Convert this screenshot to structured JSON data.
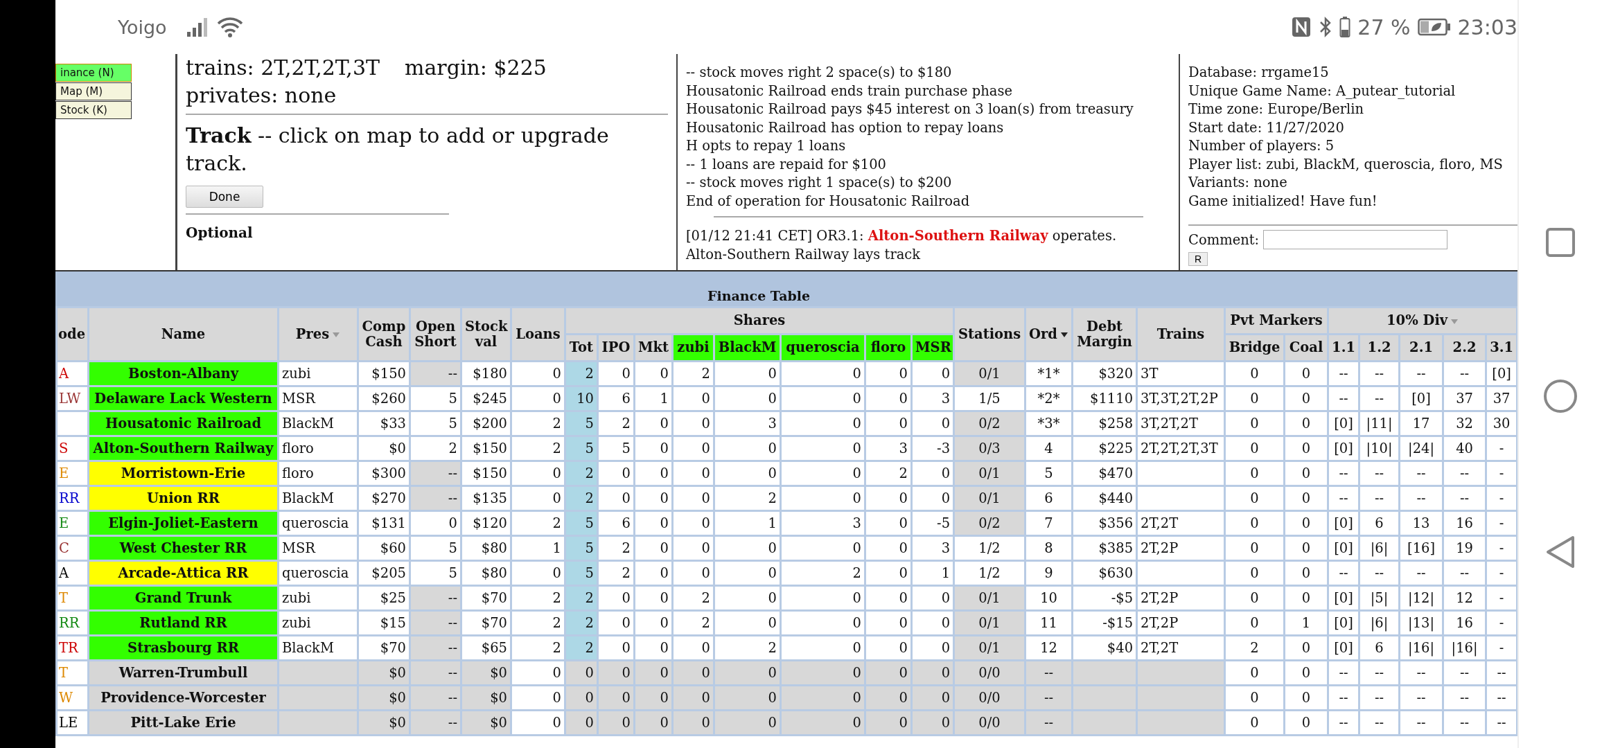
{
  "status_bar": {
    "carrier": "Yoigo",
    "battery": "27 %",
    "time": "23:03"
  },
  "view_buttons": [
    {
      "label": "inance (N)",
      "selected": true
    },
    {
      "label": "Map (M)",
      "selected": false
    },
    {
      "label": "Stock (K)",
      "selected": false
    }
  ],
  "action_panel": {
    "trains": "trains: 2T,2T,2T,3T",
    "margin": "margin: $225",
    "privates": "privates: none",
    "track": "**Track** -- click on map to add or upgrade track.",
    "done_button": "Done",
    "optional_heading": "Optional"
  },
  "log": {
    "lines": [
      "-- stock moves right 2 space(s) to $180",
      "Housatonic Railroad ends train purchase phase",
      "Housatonic Railroad pays $45 interest on 3 loan(s) from treasury",
      "Housatonic Railroad has option to repay loans",
      "H opts to repay 1 loans",
      "-- 1 loans are repaid for $100",
      "-- stock moves right 1 space(s) to $200",
      "End of operation for Housatonic Railroad"
    ],
    "entry": {
      "prefix": "[01/12 21:41 CET] OR3.1:",
      "company": "Alton-Southern Railway",
      "suffix": "operates.",
      "detail": "Alton-Southern Railway lays track"
    }
  },
  "game_info": {
    "lines": [
      "Database: rrgame15",
      "Unique Game Name: A_putear_tutorial",
      "Time zone: Europe/Berlin",
      "Start date: 11/27/2020",
      "Number of players: 5",
      "Player list: zubi, BlackM, queroscia, floro, MS",
      "Variants: none",
      "Game initialized! Have fun!"
    ],
    "comment_label": "Comment:",
    "reply_button": "R"
  },
  "finance_table": {
    "title": "Finance Table",
    "columns": [
      {
        "label": "ode",
        "sortable": false
      },
      {
        "label": "Name",
        "sortable": false
      },
      {
        "label": "Pres",
        "sortable": true
      },
      {
        "label": "Comp Cash",
        "sortable": false
      },
      {
        "label": "Open Short",
        "sortable": false
      },
      {
        "label": "Stock val",
        "sortable": false
      },
      {
        "label": "Loans",
        "sortable": false
      }
    ],
    "shares": {
      "label": "Shares",
      "columns": [
        {
          "label": "Tot",
          "player": false
        },
        {
          "label": "IPO",
          "player": false
        },
        {
          "label": "Mkt",
          "player": false
        },
        {
          "label": "zubi",
          "player": true
        },
        {
          "label": "BlackM",
          "player": true
        },
        {
          "label": "queroscia",
          "player": true
        },
        {
          "label": "floro",
          "player": true
        },
        {
          "label": "MSR",
          "player": true
        }
      ]
    },
    "tail_columns": [
      {
        "label": "Stations",
        "sortable": false
      },
      {
        "label": "Ord",
        "sortable": true
      },
      {
        "label": "Debt Margin",
        "sortable": false
      },
      {
        "label": "Trains",
        "sortable": false
      }
    ],
    "pvt_markers": {
      "label": "Pvt Markers",
      "columns": [
        "Bridge",
        "Coal"
      ]
    },
    "dividends": {
      "label": "10% Div",
      "sortable": true,
      "columns": [
        "1.1",
        "1.2",
        "2.1",
        "2.2",
        "3.1"
      ]
    },
    "rows": [
      {
        "code": {
          "text": "A",
          "color": "#cc0000"
        },
        "name": {
          "text": "Boston-Albany",
          "color": "#33ff00"
        },
        "inactive": false,
        "pres": "zubi",
        "cash": "$150",
        "open_short": "--",
        "short_shaded": true,
        "stock_val": "$180",
        "loans": "0",
        "shares": [
          "2",
          "0",
          "0",
          "2",
          "0",
          "0",
          "0",
          "0"
        ],
        "stations": "0/1",
        "stations_shaded": true,
        "ord": "*1*",
        "debt_margin": "$320",
        "trains": "3T",
        "pvt": [
          "0",
          "0"
        ],
        "div": [
          "--",
          "--",
          "--",
          "--",
          "[0]"
        ]
      },
      {
        "code": {
          "text": "LW",
          "color": "#993333"
        },
        "name": {
          "text": "Delaware Lack Western",
          "color": "#33ff00"
        },
        "inactive": false,
        "pres": "MSR",
        "cash": "$260",
        "open_short": "5",
        "short_shaded": false,
        "stock_val": "$245",
        "loans": "0",
        "shares": [
          "10",
          "6",
          "1",
          "0",
          "0",
          "0",
          "0",
          "3"
        ],
        "stations": "1/5",
        "stations_shaded": false,
        "ord": "*2*",
        "debt_margin": "$1110",
        "trains": "3T,3T,2T,2P",
        "pvt": [
          "0",
          "0"
        ],
        "div": [
          "--",
          "--",
          "[0]",
          "37",
          "37"
        ]
      },
      {
        "name": {
          "text": "Housatonic Railroad",
          "color": "#33ff00"
        },
        "inactive": false,
        "pres": "BlackM",
        "cash": "$33",
        "open_short": "5",
        "short_shaded": false,
        "stock_val": "$200",
        "loans": "2",
        "shares": [
          "5",
          "2",
          "0",
          "0",
          "3",
          "0",
          "0",
          "0"
        ],
        "stations": "0/2",
        "stations_shaded": true,
        "ord": "*3*",
        "debt_margin": "$258",
        "trains": "3T,2T,2T",
        "pvt": [
          "0",
          "0"
        ],
        "div": [
          "[0]",
          "|11|",
          "17",
          "32",
          "30"
        ]
      },
      {
        "code": {
          "text": "S",
          "color": "#cc0000"
        },
        "name": {
          "text": "Alton-Southern Railway",
          "color": "#33ff00"
        },
        "inactive": false,
        "pres": "floro",
        "cash": "$0",
        "open_short": "2",
        "short_shaded": false,
        "stock_val": "$150",
        "loans": "2",
        "shares": [
          "5",
          "5",
          "0",
          "0",
          "0",
          "0",
          "3",
          "-3"
        ],
        "stations": "0/3",
        "stations_shaded": true,
        "ord": "4",
        "debt_margin": "$225",
        "trains": "2T,2T,2T,3T",
        "pvt": [
          "0",
          "0"
        ],
        "div": [
          "[0]",
          "|10|",
          "|24|",
          "40",
          "-"
        ]
      },
      {
        "code": {
          "text": "E",
          "color": "#dd8800"
        },
        "name": {
          "text": "Morristown-Erie",
          "color": "#ffff00"
        },
        "inactive": false,
        "pres": "floro",
        "cash": "$300",
        "open_short": "--",
        "short_shaded": true,
        "stock_val": "$150",
        "loans": "0",
        "shares": [
          "2",
          "0",
          "0",
          "0",
          "0",
          "0",
          "2",
          "0"
        ],
        "stations": "0/1",
        "stations_shaded": true,
        "ord": "5",
        "debt_margin": "$470",
        "pvt": [
          "0",
          "0"
        ],
        "div": [
          "--",
          "--",
          "--",
          "--",
          "-"
        ]
      },
      {
        "code": {
          "text": "RR",
          "color": "#0000cc"
        },
        "name": {
          "text": "Union RR",
          "color": "#ffff00"
        },
        "inactive": false,
        "pres": "BlackM",
        "cash": "$270",
        "open_short": "--",
        "short_shaded": true,
        "stock_val": "$135",
        "loans": "0",
        "shares": [
          "2",
          "0",
          "0",
          "0",
          "2",
          "0",
          "0",
          "0"
        ],
        "stations": "0/1",
        "stations_shaded": true,
        "ord": "6",
        "debt_margin": "$440",
        "pvt": [
          "0",
          "0"
        ],
        "div": [
          "--",
          "--",
          "--",
          "--",
          "-"
        ]
      },
      {
        "code": {
          "text": "E",
          "color": "#118811"
        },
        "name": {
          "text": "Elgin-Joliet-Eastern",
          "color": "#33ff00"
        },
        "inactive": false,
        "pres": "queroscia",
        "cash": "$131",
        "open_short": "0",
        "short_shaded": false,
        "stock_val": "$120",
        "loans": "2",
        "shares": [
          "5",
          "6",
          "0",
          "0",
          "1",
          "3",
          "0",
          "-5"
        ],
        "stations": "0/2",
        "stations_shaded": true,
        "ord": "7",
        "debt_margin": "$356",
        "trains": "2T,2T",
        "pvt": [
          "0",
          "0"
        ],
        "div": [
          "[0]",
          "6",
          "13",
          "16",
          "-"
        ]
      },
      {
        "code": {
          "text": "C",
          "color": "#993333"
        },
        "name": {
          "text": "West Chester RR",
          "color": "#33ff00"
        },
        "inactive": false,
        "pres": "MSR",
        "cash": "$60",
        "open_short": "5",
        "short_shaded": false,
        "stock_val": "$80",
        "loans": "1",
        "shares": [
          "5",
          "2",
          "0",
          "0",
          "0",
          "0",
          "0",
          "3"
        ],
        "stations": "1/2",
        "stations_shaded": false,
        "ord": "8",
        "debt_margin": "$385",
        "trains": "2T,2P",
        "pvt": [
          "0",
          "0"
        ],
        "div": [
          "[0]",
          "|6|",
          "[16]",
          "19",
          "-"
        ]
      },
      {
        "code": {
          "text": "A",
          "color": "#000000"
        },
        "name": {
          "text": "Arcade-Attica RR",
          "color": "#ffff00"
        },
        "inactive": false,
        "pres": "queroscia",
        "cash": "$205",
        "open_short": "5",
        "short_shaded": false,
        "stock_val": "$80",
        "loans": "0",
        "shares": [
          "5",
          "2",
          "0",
          "0",
          "0",
          "2",
          "0",
          "1"
        ],
        "stations": "1/2",
        "stations_shaded": false,
        "ord": "9",
        "debt_margin": "$630",
        "pvt": [
          "0",
          "0"
        ],
        "div": [
          "--",
          "--",
          "--",
          "--",
          "-"
        ]
      },
      {
        "code": {
          "text": "T",
          "color": "#dd8800"
        },
        "name": {
          "text": "Grand Trunk",
          "color": "#33ff00"
        },
        "inactive": false,
        "pres": "zubi",
        "cash": "$25",
        "open_short": "--",
        "short_shaded": true,
        "stock_val": "$70",
        "loans": "2",
        "shares": [
          "2",
          "0",
          "0",
          "2",
          "0",
          "0",
          "0",
          "0"
        ],
        "stations": "0/1",
        "stations_shaded": true,
        "ord": "10",
        "debt_margin": "-$5",
        "trains": "2T,2P",
        "pvt": [
          "0",
          "0"
        ],
        "div": [
          "[0]",
          "|5|",
          "|12|",
          "12",
          "-"
        ]
      },
      {
        "code": {
          "text": "RR",
          "color": "#118811"
        },
        "name": {
          "text": "Rutland RR",
          "color": "#33ff00"
        },
        "inactive": false,
        "pres": "zubi",
        "cash": "$15",
        "open_short": "--",
        "short_shaded": true,
        "stock_val": "$70",
        "loans": "2",
        "shares": [
          "2",
          "0",
          "0",
          "2",
          "0",
          "0",
          "0",
          "0"
        ],
        "stations": "0/1",
        "stations_shaded": true,
        "ord": "11",
        "debt_margin": "-$15",
        "trains": "2T,2P",
        "pvt": [
          "0",
          "1"
        ],
        "div": [
          "[0]",
          "|6|",
          "|13|",
          "16",
          "-"
        ]
      },
      {
        "code": {
          "text": "TR",
          "color": "#cc0000"
        },
        "name": {
          "text": "Strasbourg RR",
          "color": "#33ff00"
        },
        "inactive": false,
        "pres": "BlackM",
        "cash": "$70",
        "open_short": "--",
        "short_shaded": true,
        "stock_val": "$65",
        "loans": "2",
        "shares": [
          "2",
          "0",
          "0",
          "0",
          "2",
          "0",
          "0",
          "0"
        ],
        "stations": "0/1",
        "stations_shaded": true,
        "ord": "12",
        "debt_margin": "$40",
        "trains": "2T,2T",
        "pvt": [
          "2",
          "0"
        ],
        "div": [
          "[0]",
          "6",
          "|16|",
          "|16|",
          "-"
        ]
      },
      {
        "code": {
          "text": "T",
          "color": "#dd8800"
        },
        "name": {
          "text": "Warren-Trumbull",
          "color": "#d6d6d6"
        },
        "inactive": true,
        "cash": "$0",
        "open_short": "--",
        "short_shaded": true,
        "stock_val": "$0",
        "loans": "0",
        "shares": [
          "0",
          "0",
          "0",
          "0",
          "0",
          "0",
          "0",
          "0"
        ],
        "stations": "0/0",
        "stations_shaded": true,
        "ord": "--",
        "pvt": [
          "0",
          "0"
        ],
        "div": [
          "--",
          "--",
          "--",
          "--",
          "--"
        ]
      },
      {
        "code": {
          "text": "W",
          "color": "#dd8800"
        },
        "name": {
          "text": "Providence-Worcester",
          "color": "#d6d6d6"
        },
        "inactive": true,
        "cash": "$0",
        "open_short": "--",
        "short_shaded": true,
        "stock_val": "$0",
        "loans": "0",
        "shares": [
          "0",
          "0",
          "0",
          "0",
          "0",
          "0",
          "0",
          "0"
        ],
        "stations": "0/0",
        "stations_shaded": true,
        "ord": "--",
        "pvt": [
          "0",
          "0"
        ],
        "div": [
          "--",
          "--",
          "--",
          "--",
          "--"
        ]
      },
      {
        "code": {
          "text": "LE",
          "color": "#000000"
        },
        "name": {
          "text": "Pitt-Lake Erie",
          "color": "#d6d6d6"
        },
        "inactive": true,
        "cash": "$0",
        "open_short": "--",
        "short_shaded": true,
        "stock_val": "$0",
        "loans": "0",
        "shares": [
          "0",
          "0",
          "0",
          "0",
          "0",
          "0",
          "0",
          "0"
        ],
        "stations": "0/0",
        "stations_shaded": true,
        "ord": "--",
        "pvt": [
          "0",
          "0"
        ],
        "div": [
          "--",
          "--",
          "--",
          "--",
          "--"
        ]
      }
    ]
  }
}
